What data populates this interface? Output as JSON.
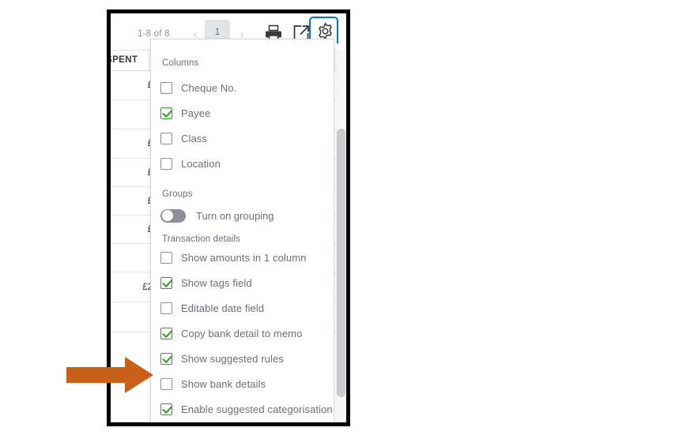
{
  "toolbar": {
    "range_label": "1-8 of 8",
    "prev_label": "‹",
    "next_label": "›",
    "current_page": "1",
    "print_icon": "printer-icon",
    "export_icon": "export-icon",
    "gear_icon": "gear-icon",
    "gear_highlight_color": "#0077c5"
  },
  "table": {
    "column_header": "SPENT",
    "rows": [
      {
        "amount": "£"
      },
      {
        "amount": ""
      },
      {
        "amount": "£"
      },
      {
        "amount": "£"
      },
      {
        "amount": "£"
      },
      {
        "amount": "£"
      },
      {
        "amount": ""
      },
      {
        "amount": "£2"
      },
      {
        "amount": ""
      },
      {
        "amount": ""
      }
    ]
  },
  "settings_menu": {
    "sections": [
      {
        "title": "Columns",
        "items": [
          {
            "label": "Cheque No.",
            "checked": false,
            "control": "checkbox"
          },
          {
            "label": "Payee",
            "checked": true,
            "control": "checkbox"
          },
          {
            "label": "Class",
            "checked": false,
            "control": "checkbox"
          },
          {
            "label": "Location",
            "checked": false,
            "control": "checkbox"
          }
        ]
      },
      {
        "title": "Groups",
        "items": [
          {
            "label": "Turn on grouping",
            "checked": false,
            "control": "toggle"
          }
        ]
      },
      {
        "title": "Transaction details",
        "items": [
          {
            "label": "Show amounts in 1 column",
            "checked": false,
            "control": "checkbox"
          },
          {
            "label": "Show tags field",
            "checked": true,
            "control": "checkbox"
          },
          {
            "label": "Editable date field",
            "checked": false,
            "control": "checkbox"
          },
          {
            "label": "Copy bank detail to memo",
            "checked": true,
            "control": "checkbox"
          },
          {
            "label": "Show suggested rules",
            "checked": true,
            "control": "checkbox"
          },
          {
            "label": "Show bank details",
            "checked": false,
            "control": "checkbox"
          },
          {
            "label": "Enable suggested categorisation",
            "checked": true,
            "control": "checkbox"
          }
        ]
      }
    ],
    "checked_color": "#2ca01c",
    "unchecked_color": "#8d9096"
  },
  "annotation": {
    "arrow_color": "#c8601a",
    "arrow_direction": "right",
    "points_to": "Show bank details"
  }
}
